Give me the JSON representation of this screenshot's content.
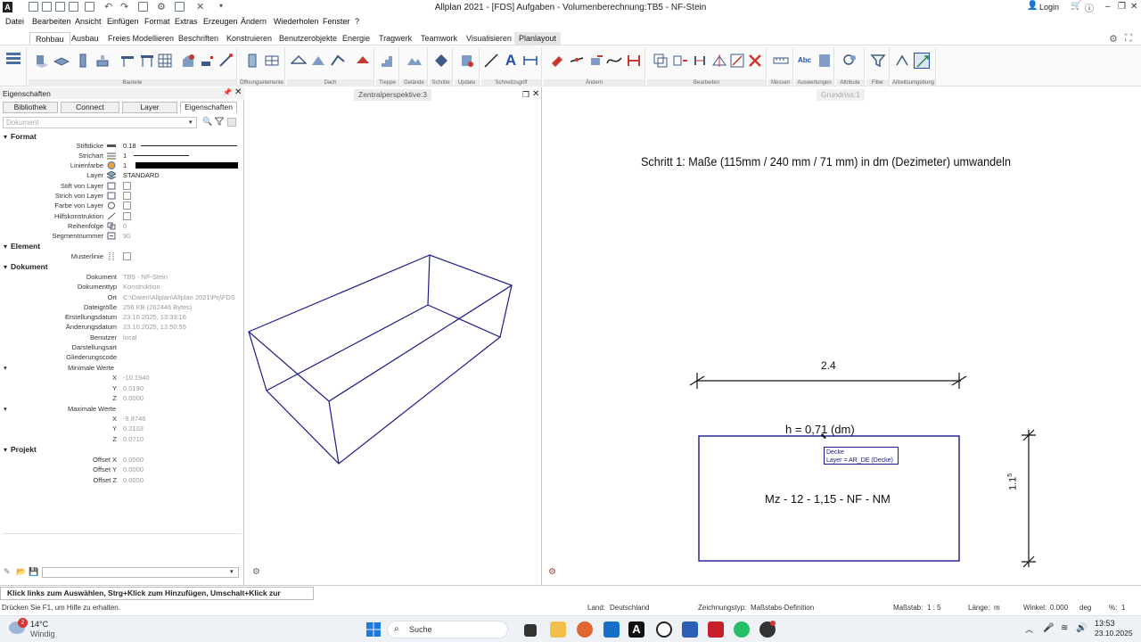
{
  "titlebar": {
    "title": "Allplan 2021 - [FDS] Aufgaben - Volumenberechnung:TB5 - NF-Stein",
    "login": "Login",
    "app_logo": "A"
  },
  "menu": [
    "Datei",
    "Bearbeiten",
    "Ansicht",
    "Einfügen",
    "Format",
    "Extras",
    "Erzeugen",
    "Ändern",
    "Wiederholen",
    "Fenster",
    "?"
  ],
  "ribbon": {
    "tabs": [
      "Rohbau",
      "Ausbau",
      "Freies Modellieren",
      "Beschriften",
      "Konstruieren",
      "Benutzerobjekte",
      "Energie",
      "Tragwerk",
      "Teamwork",
      "Visualisieren",
      "Planlayout"
    ],
    "active_tab": "Rohbau",
    "groups": [
      "Bauteile",
      "Öffnungselemente",
      "Dach",
      "Treppe",
      "Gelände",
      "Schritte",
      "Update",
      "Schnellzugriff",
      "Ändern",
      "Bearbeiten",
      "Messen",
      "Auswertungen",
      "Attribute",
      "Filter",
      "Arbeitsumgebung"
    ]
  },
  "panel": {
    "header": "Eigenschaften",
    "tabs": [
      "Bibliothek",
      "Connect",
      "Layer",
      "Eigenschaften"
    ],
    "active_tab": "Eigenschaften",
    "doc_select": "Dokument",
    "format": {
      "title": "Format",
      "rows": [
        {
          "label": "Stiftdicke",
          "value": "0.18"
        },
        {
          "label": "Strichart",
          "value": "1"
        },
        {
          "label": "Linienfarbe",
          "value": "1"
        },
        {
          "label": "Layer",
          "value": "STANDARD"
        },
        {
          "label": "Stift von Layer",
          "value": ""
        },
        {
          "label": "Strich von Layer",
          "value": ""
        },
        {
          "label": "Farbe von Layer",
          "value": ""
        },
        {
          "label": "Hilfskonstruktion",
          "value": ""
        },
        {
          "label": "Reihenfolge",
          "value": "0"
        },
        {
          "label": "Segmentnummer",
          "value": "90"
        }
      ]
    },
    "element": {
      "title": "Element",
      "rows": [
        {
          "label": "Musterlinie",
          "value": ""
        }
      ]
    },
    "dokument": {
      "title": "Dokument",
      "rows": [
        {
          "label": "Dokument",
          "value": "TB5 - NF-Stein"
        },
        {
          "label": "Dokumenttyp",
          "value": "Konstruktion"
        },
        {
          "label": "Ort",
          "value": "C:\\Daten\\Allplan\\Allplan 2021\\Prj\\FDS"
        },
        {
          "label": "Dateigröße",
          "value": "256 KB (262446 Bytes)"
        },
        {
          "label": "Erstellungsdatum",
          "value": "23.10.2025, 13:33:16"
        },
        {
          "label": "Änderungsdatum",
          "value": "23.10.2025, 13:50:55"
        },
        {
          "label": "Benutzer",
          "value": "local"
        },
        {
          "label": "Darstellungsart",
          "value": ""
        },
        {
          "label": "Gliederungscode",
          "value": ""
        }
      ],
      "min": {
        "title": "Minimale Werte",
        "x": "-10.1940",
        "y": "0.0190",
        "z": "0.0000"
      },
      "max": {
        "title": "Maximale Werte",
        "x": "-9.8746",
        "y": "0.2103",
        "z": "0.0710"
      }
    },
    "projekt": {
      "title": "Projekt",
      "rows": [
        {
          "label": "Offset X",
          "value": "0.0000"
        },
        {
          "label": "Offset Y",
          "value": "0.0000"
        },
        {
          "label": "Offset Z",
          "value": "0.0000"
        }
      ]
    }
  },
  "viewports": {
    "perspective_title": "Zentralperspektive:3",
    "plan_title": "Grundriss:1"
  },
  "drawing": {
    "heading": "Schritt 1: Maße (115mm / 240 mm / 71 mm) in dm (Dezimeter) umwandeln",
    "dim_top": "2.4",
    "height_label": "h =  0,71 (dm)",
    "tooltip_line1": "Decke",
    "tooltip_line2": "Layer   = AR_DE (Decke)",
    "center_label": "Mz - 12 - 1,15 - NF - NM",
    "dim_side": "1.15",
    "dim_side_main": "1.1",
    "dim_side_sup": "5"
  },
  "hint": "Klick links zum Auswählen, Strg+Klick zum Hinzufügen, Umschalt+Klick zur Segmentwahl",
  "status": {
    "help": "Drücken Sie F1, um Hilfe zu erhalten.",
    "land_label": "Land:",
    "land": "Deutschland",
    "zeichnungstyp_label": "Zeichnungstyp:",
    "zeichnungstyp": "Maßstabs-Definition",
    "massstab_label": "Maßstab:",
    "massstab": "1 : 5",
    "laenge_label": "Länge:",
    "laenge": "m",
    "winkel_label": "Winkel:",
    "winkel": "0.000",
    "winkel_unit": "deg",
    "percent_label": "%:",
    "percent": "1"
  },
  "taskbar": {
    "weather_temp": "14°C",
    "weather_text": "Windig",
    "weather_badge": "2",
    "search": "Suche",
    "time": "13:53",
    "date": "23.10.2025"
  },
  "colors": {
    "accent": "#1f4fa8",
    "drawing_line": "#1a1a8c"
  }
}
